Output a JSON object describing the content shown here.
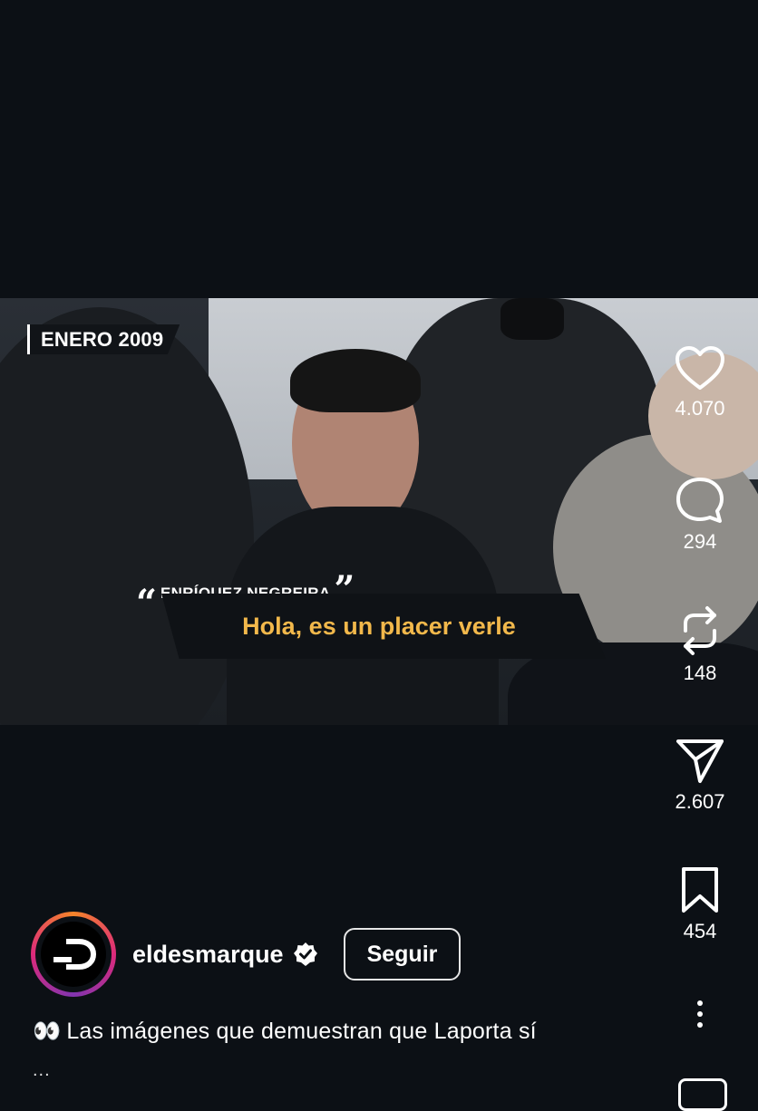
{
  "video": {
    "date_tag": "ENERO 2009",
    "speaker_name": "ENRÍQUEZ NEGREIRA",
    "quote_open": "“",
    "quote_close": "”",
    "subtitle": "Hola, es un placer verle",
    "subtitle_color": "#f2b84b"
  },
  "actions": {
    "likes": "4.070",
    "comments": "294",
    "reposts": "148",
    "shares": "2.607",
    "saves": "454"
  },
  "profile": {
    "username": "eldesmarque",
    "follow_label": "Seguir"
  },
  "caption": {
    "emoji": "👀",
    "text": "Las imágenes que demuestran que Laporta sí",
    "more": "..."
  },
  "colors": {
    "background": "#0c1015",
    "ring_gradient": [
      "#f58529",
      "#dd2a7b",
      "#8134af"
    ]
  }
}
